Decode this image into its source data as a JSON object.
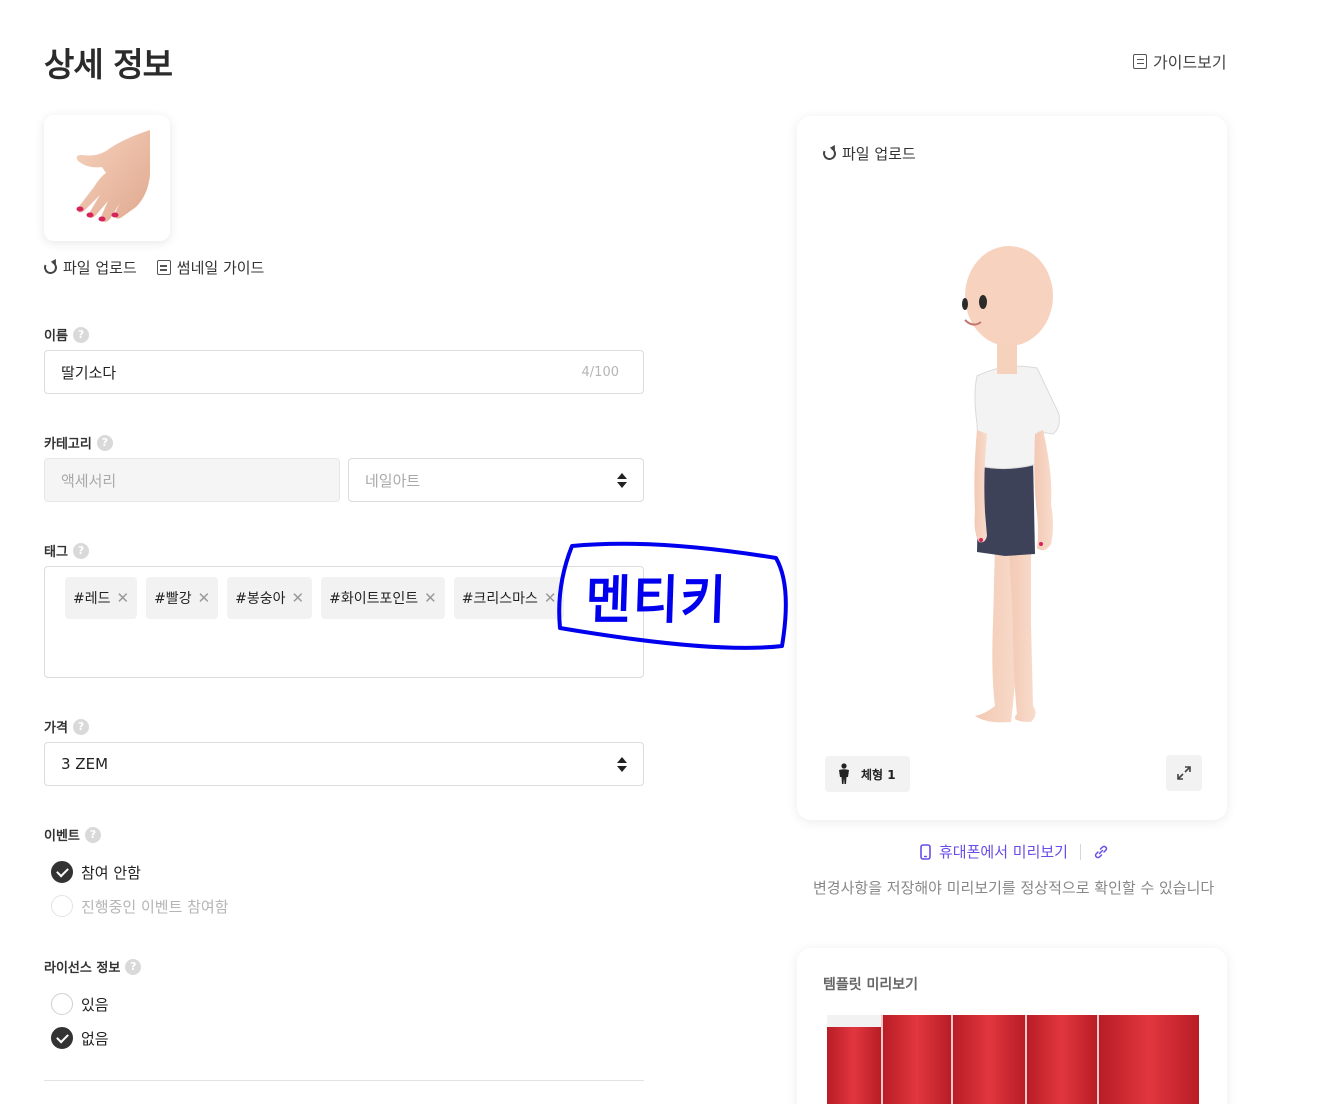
{
  "header": {
    "title": "상세 정보",
    "guide_link": "가이드보기"
  },
  "thumbnail": {
    "upload_label": "파일 업로드",
    "guide_label": "썸네일 가이드"
  },
  "name_field": {
    "label": "이름",
    "value": "딸기소다",
    "counter": "4/100"
  },
  "category_field": {
    "label": "카테고리",
    "main_value": "액세서리",
    "sub_value": "네일아트"
  },
  "tag_field": {
    "label": "태그",
    "tags": [
      "#레드",
      "#빨강",
      "#봉숭아",
      "#화이트포인트",
      "#크리스마스"
    ]
  },
  "price_field": {
    "label": "가격",
    "value": "3 ZEM"
  },
  "event_field": {
    "label": "이벤트",
    "options": [
      {
        "label": "참여 안함",
        "checked": true,
        "disabled": false
      },
      {
        "label": "진행중인 이벤트 참여함",
        "checked": false,
        "disabled": true
      }
    ]
  },
  "license_field": {
    "label": "라이선스 정보",
    "options": [
      {
        "label": "있음",
        "checked": false
      },
      {
        "label": "없음",
        "checked": true
      }
    ]
  },
  "preview": {
    "upload_label": "파일 업로드",
    "body_type_label": "체형 1",
    "mobile_preview_label": "휴대폰에서 미리보기",
    "notice": "변경사항을 저장해야 미리보기를 정상적으로 확인할 수 있습니다"
  },
  "template": {
    "title": "템플릿 미리보기"
  },
  "annotation": {
    "handwritten_text": "멘티키"
  },
  "colors": {
    "accent": "#6a4de8",
    "scribble": "#0000ee",
    "checked_radio": "#333333"
  }
}
